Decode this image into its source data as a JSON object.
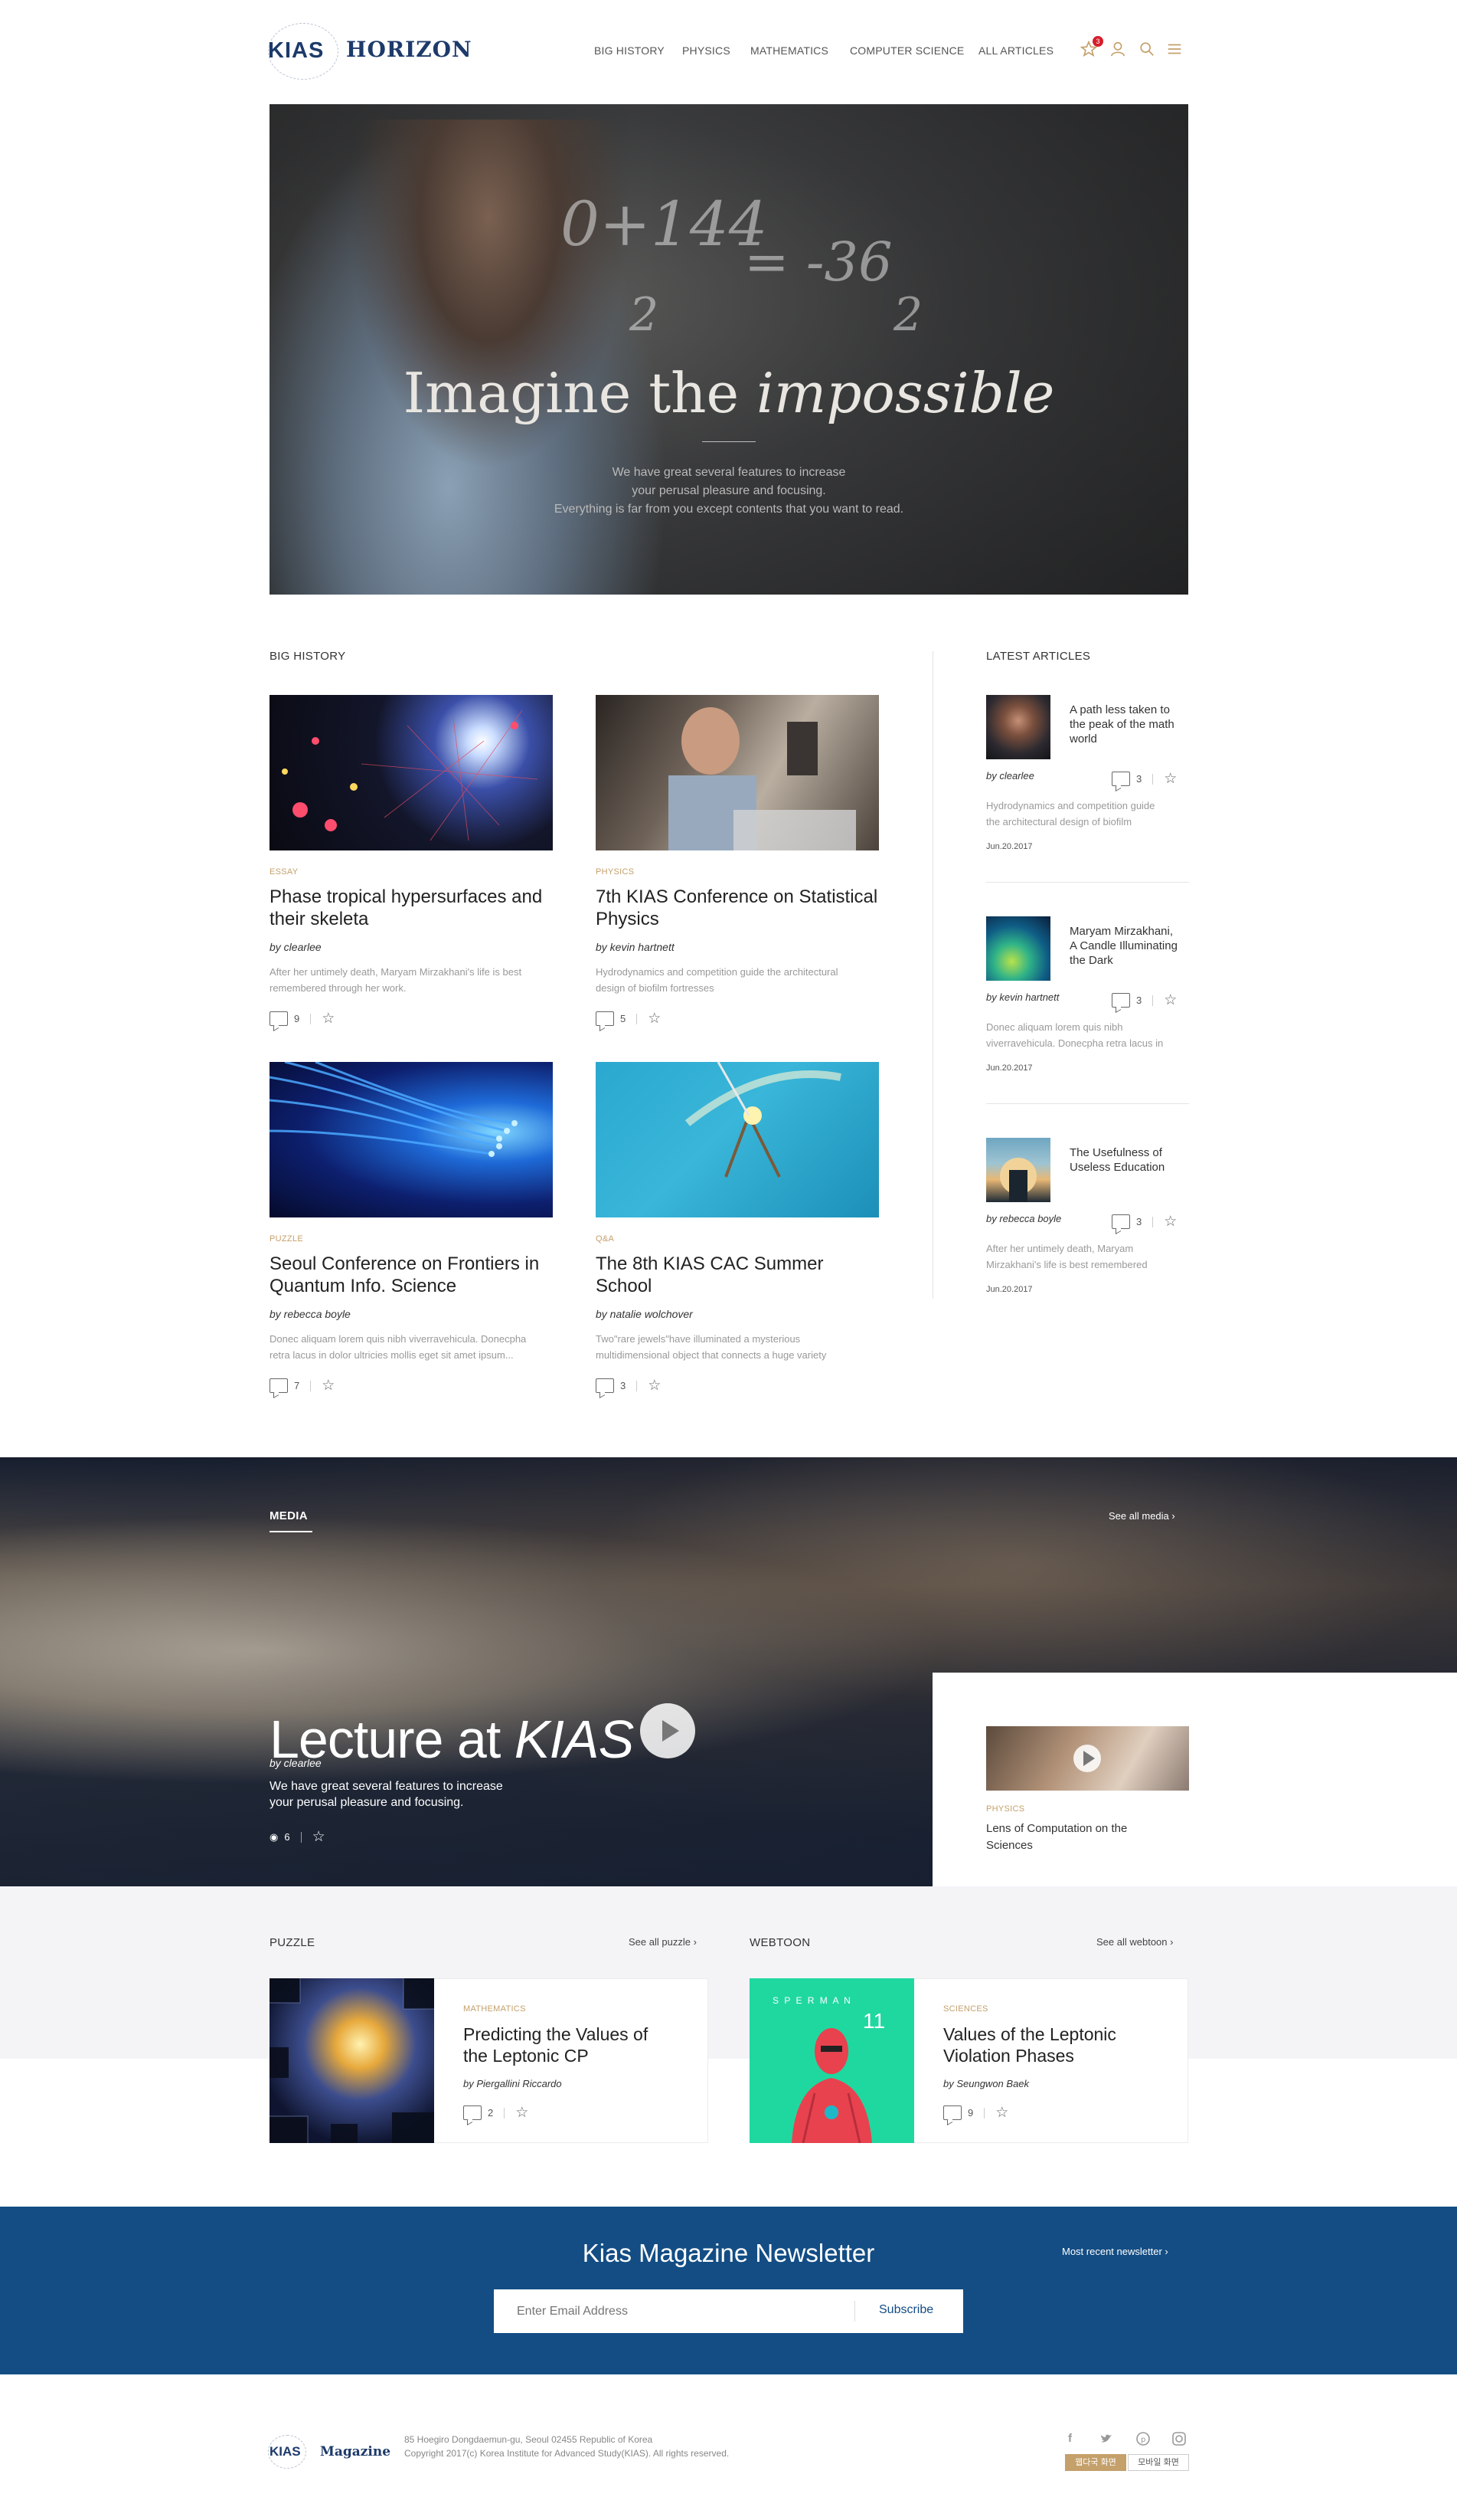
{
  "header": {
    "logo_kias": "KIAS",
    "logo_horizon": "HORIZON",
    "nav": [
      "BIG HISTORY",
      "PHYSICS",
      "MATHEMATICS",
      "COMPUTER SCIENCE",
      "ALL ARTICLES"
    ],
    "favorites_count": "3"
  },
  "hero": {
    "title_plain": "Imagine the ",
    "title_italic": "impossible",
    "line1": "We have great several features to increase",
    "line2": "your perusal pleasure and focusing.",
    "line3": "Everything is far from you except contents that you want to read."
  },
  "big_history": {
    "title": "BIG HISTORY",
    "cards": [
      {
        "category": "ESSAY",
        "title1": "Phase tropical hypersurfaces and",
        "title2": "their skeleta",
        "byline": "by clearlee",
        "ex1": "After her untimely death, Maryam Mirzakhani's life is best",
        "ex2": "remembered through her work.",
        "comments": "9"
      },
      {
        "category": "PHYSICS",
        "title1": "7th KIAS Conference on Statistical",
        "title2": "Physics",
        "byline": "by kevin hartnett",
        "ex1": "Hydrodynamics and competition guide the architectural",
        "ex2": "design of biofilm fortresses",
        "comments": "5"
      },
      {
        "category": "PUZZLE",
        "title1": "Seoul Conference on Frontiers in",
        "title2": "Quantum Info. Science",
        "byline": "by rebecca boyle",
        "ex1": "Donec aliquam lorem quis nibh viverravehicula. Donecpha",
        "ex2": "retra lacus in dolor ultricies mollis eget sit amet ipsum...",
        "comments": "7"
      },
      {
        "category": "Q&A",
        "title1": "The 8th KIAS CAC Summer School",
        "title2": "",
        "byline": "by natalie wolchover",
        "ex1": "Two\"rare jewels\"have illuminated a mysterious",
        "ex2": "multidimensional object that connects a huge variety",
        "comments": "3"
      }
    ]
  },
  "latest": {
    "title": "LATEST ARTICLES",
    "items": [
      {
        "t1": "A path less taken to",
        "t2": "the peak of the math",
        "t3": "world",
        "byline": "by clearlee",
        "comments": "3",
        "ex1": "Hydrodynamics and competition guide",
        "ex2": "the architectural design of biofilm",
        "date": "Jun.20.2017"
      },
      {
        "t1": "Maryam Mirzakhani,",
        "t2": "A Candle Illuminating",
        "t3": "the Dark",
        "byline": "by kevin hartnett",
        "comments": "3",
        "ex1": "Donec aliquam lorem quis nibh",
        "ex2": "viverravehicula. Donecpha retra lacus in",
        "date": "Jun.20.2017"
      },
      {
        "t1": "The Usefulness of",
        "t2": "Useless Education",
        "t3": "",
        "byline": "by rebecca boyle",
        "comments": "3",
        "ex1": "After her untimely death, Maryam",
        "ex2": "Mirzakhani's life is best remembered",
        "date": "Jun.20.2017"
      }
    ]
  },
  "media": {
    "label": "MEDIA",
    "see_all": "See all media",
    "title_plain": "Lecture at ",
    "title_italic": "KIAS",
    "byline": "by clearlee",
    "desc1": "We have great several features to increase",
    "desc2": "your perusal pleasure and focusing.",
    "views": "6",
    "side_category": "PHYSICS",
    "side_title1": "Lens of Computation on the",
    "side_title2": "Sciences"
  },
  "puzzle": {
    "label": "PUZZLE",
    "see_all": "See all puzzle",
    "category": "MATHEMATICS",
    "title1": "Predicting the Values of",
    "title2": "the Leptonic CP",
    "byline": "by Piergallini Riccardo",
    "comments": "2"
  },
  "webtoon": {
    "label": "WEBTOON",
    "see_all": "See all webtoon",
    "category": "SCIENCES",
    "title1": "Values of the Leptonic",
    "title2": "Violation Phases",
    "byline": "by Seungwon Baek",
    "comments": "9",
    "art_text": "S P E R M A N",
    "art_number": "11"
  },
  "newsletter": {
    "title": "Kias Magazine Newsletter",
    "recent": "Most recent newsletter",
    "placeholder": "Enter Email Address",
    "subscribe": "Subscribe"
  },
  "footer": {
    "logo_kias": "KIAS",
    "logo_magazine": "Magazine",
    "address": "85 Hoegiro Dongdaemun-gu, Seoul 02455 Republic of Korea",
    "copyright": "Copyright 2017(c) Korea Institute for Advanced Study(KIAS). All rights reserved.",
    "btn_web": "웹다국 화면",
    "btn_mobile": "모바일 화면"
  },
  "colors": {
    "brand": "#1d3a6a",
    "accent": "#c4a06b",
    "newsletter": "#134d84",
    "badge": "#d61e2a"
  }
}
